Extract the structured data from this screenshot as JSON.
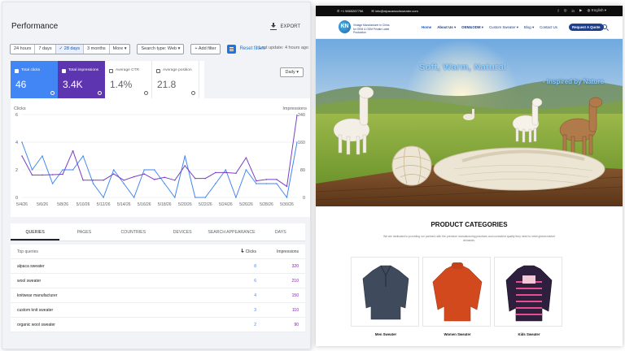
{
  "gsc": {
    "title": "Performance",
    "export_label": "EXPORT",
    "date_ranges": [
      "24 hours",
      "7 days",
      "28 days",
      "3 months",
      "More"
    ],
    "selected_range": "28 days",
    "search_type": "Search type: Web",
    "add_filter": "Add filter",
    "reset_filters": "Reset filters",
    "last_update": "Last update: 4 hours ago",
    "metrics": [
      {
        "label": "Total clicks",
        "value": "46",
        "checked": true,
        "color": "#4285f4"
      },
      {
        "label": "Total impressions",
        "value": "3.4K",
        "checked": true,
        "color": "#5e35b1"
      },
      {
        "label": "Average CTR",
        "value": "1.4%",
        "checked": false
      },
      {
        "label": "Average position",
        "value": "21.8",
        "checked": false
      }
    ],
    "granularity": "Daily",
    "tabs": [
      "QUERIES",
      "PAGES",
      "COUNTRIES",
      "DEVICES",
      "SEARCH APPEARANCE",
      "DAYS"
    ],
    "active_tab": "QUERIES",
    "table": {
      "headers": [
        "Top queries",
        "Clicks",
        "Impressions"
      ],
      "rows": [
        [
          "alpaca sweater",
          "8",
          "320"
        ],
        [
          "wool sweater",
          "6",
          "210"
        ],
        [
          "knitwear manufacturer",
          "4",
          "150"
        ],
        [
          "custom knit sweater",
          "3",
          "110"
        ],
        [
          "organic wool sweater",
          "2",
          "90"
        ]
      ]
    }
  },
  "chart_data": {
    "type": "line",
    "x": [
      "5/4/26",
      "5/5/26",
      "5/6/26",
      "5/7/26",
      "5/8/26",
      "5/9/26",
      "5/10/26",
      "5/11/26",
      "5/12/26",
      "5/13/26",
      "5/14/26",
      "5/15/26",
      "5/16/26",
      "5/17/26",
      "5/18/26",
      "5/19/26",
      "5/20/26",
      "5/21/26",
      "5/22/26",
      "5/23/26",
      "5/24/26",
      "5/25/26",
      "5/26/26",
      "5/27/26",
      "5/28/26",
      "5/29/26",
      "5/30/26",
      "5/31/26"
    ],
    "tick_labels": [
      "5/4/26",
      "5/6/26",
      "5/8/26",
      "5/10/26",
      "5/12/26",
      "5/14/26",
      "5/16/26",
      "5/18/26",
      "5/20/26",
      "5/22/26",
      "5/24/26",
      "5/26/26",
      "5/28/26",
      "5/30/26"
    ],
    "series": [
      {
        "name": "Clicks",
        "axis": "left",
        "color": "#4285f4",
        "values": [
          4,
          2,
          3,
          1,
          2,
          2,
          3,
          1,
          0,
          2,
          1,
          0,
          2,
          2,
          1,
          0,
          3,
          0,
          0,
          1,
          2,
          0,
          2,
          1,
          1,
          1,
          0,
          4
        ]
      },
      {
        "name": "Impressions",
        "axis": "right",
        "color": "#7b3fc4",
        "values": [
          120,
          65,
          65,
          66,
          67,
          135,
          50,
          50,
          50,
          68,
          50,
          60,
          68,
          52,
          58,
          50,
          92,
          55,
          55,
          72,
          72,
          70,
          115,
          48,
          52,
          52,
          32,
          238
        ]
      }
    ],
    "ylabel_left": "Clicks",
    "ylabel_right": "Impressions",
    "yticks_left": [
      "0",
      "2",
      "4",
      "6"
    ],
    "yticks_right": [
      "0",
      "80",
      "160",
      "240"
    ],
    "ylim_left": [
      0,
      6
    ],
    "ylim_right": [
      0,
      240
    ],
    "grid": true
  },
  "site": {
    "phone": "+1 9865287756",
    "email": "info@alpacawoolsweater.com",
    "language": "English",
    "logo_text": "KN",
    "tagline": "Vintage Manufacturer in China for OEM & ODM Private Label Production",
    "menu": [
      "Home",
      "About Us",
      "OEM&ODM",
      "Custom Sweater",
      "Blog",
      "Contact Us"
    ],
    "quote_button": "Request A Quote",
    "hero_title": "Soft, Warm, Natural",
    "hero_subtitle": "- Inspired by Nature",
    "section_title": "PRODUCT CATEGORIES",
    "section_text": "We are dedicated to providing our partners with the premium manufacturing practices and consistent quality they need to meet global market demands.",
    "products": [
      "Men Sweater",
      "Women Sweater",
      "Kids Sweater"
    ]
  },
  "colors": {
    "clicks": "#4285f4",
    "impressions": "#5e35b1",
    "nav_blue": "#1e3f8f",
    "topbar": "#0d0d0d"
  }
}
